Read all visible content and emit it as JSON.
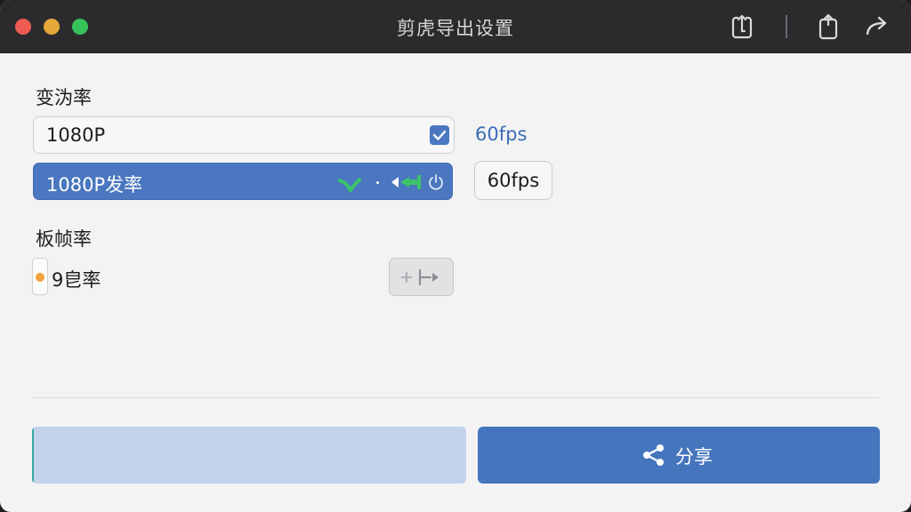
{
  "window": {
    "title": "剪虎导出设置"
  },
  "titlebar_icons": [
    "export-icon",
    "share-square-icon",
    "forward-arrow-icon"
  ],
  "section_resolution": {
    "label": "变沩率",
    "field1": {
      "value": "1080P",
      "checked": true
    },
    "fps_link": "60fps",
    "field2": {
      "value": "1080P发率"
    },
    "fps_button": "60fps"
  },
  "section_framerate": {
    "label": "板帧率",
    "value": "9皀率"
  },
  "bottom": {
    "progress": 0.005,
    "share_label": "分享"
  },
  "colors": {
    "accent": "#4a77bf",
    "green": "#3cc46a",
    "orange": "#f0a33a"
  }
}
